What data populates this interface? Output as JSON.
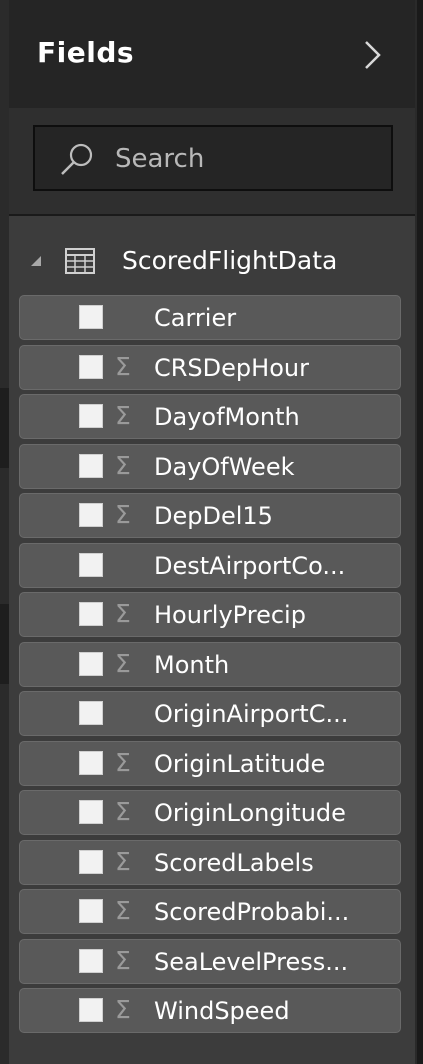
{
  "header": {
    "title": "Fields"
  },
  "search": {
    "placeholder": "Search"
  },
  "table": {
    "name": "ScoredFlightData"
  },
  "fields": [
    {
      "name": "Carrier",
      "sigma": ""
    },
    {
      "name": "CRSDepHour",
      "sigma": "Σ"
    },
    {
      "name": "DayofMonth",
      "sigma": "Σ"
    },
    {
      "name": "DayOfWeek",
      "sigma": "Σ"
    },
    {
      "name": "DepDel15",
      "sigma": "Σ"
    },
    {
      "name": "DestAirportCo...",
      "sigma": ""
    },
    {
      "name": "HourlyPrecip",
      "sigma": "Σ"
    },
    {
      "name": "Month",
      "sigma": "Σ"
    },
    {
      "name": "OriginAirportC...",
      "sigma": ""
    },
    {
      "name": "OriginLatitude",
      "sigma": "Σ"
    },
    {
      "name": "OriginLongitude",
      "sigma": "Σ"
    },
    {
      "name": "ScoredLabels",
      "sigma": "Σ"
    },
    {
      "name": "ScoredProbabi...",
      "sigma": "Σ"
    },
    {
      "name": "SeaLevelPress...",
      "sigma": "Σ"
    },
    {
      "name": "WindSpeed",
      "sigma": "Σ"
    }
  ]
}
